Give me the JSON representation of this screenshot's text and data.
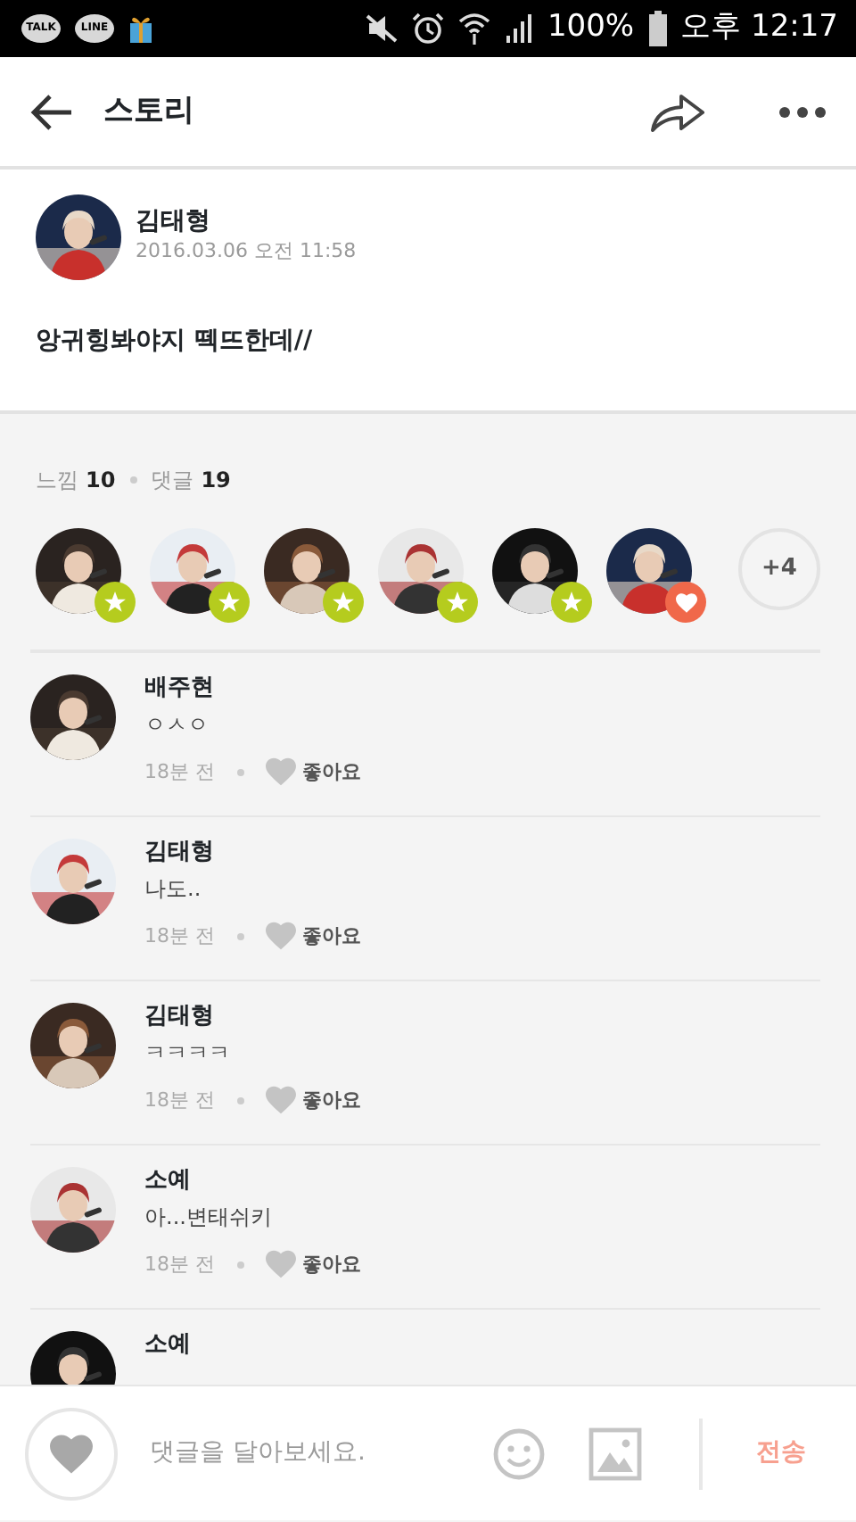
{
  "status_bar": {
    "notifications": [
      "TALK",
      "LINE"
    ],
    "battery_text": "100%",
    "time": "오후 12:17"
  },
  "header": {
    "title": "스토리"
  },
  "post": {
    "author": "김태형",
    "date": "2016.03.06 오전 11:58",
    "text": "앙귀힝봐야지 떽뜨한데//"
  },
  "stats": {
    "feel_label": "느낌",
    "feel_count": "10",
    "comment_label": "댓글",
    "comment_count": "19"
  },
  "reactors": [
    {
      "kind": "star"
    },
    {
      "kind": "star"
    },
    {
      "kind": "star"
    },
    {
      "kind": "star"
    },
    {
      "kind": "star"
    },
    {
      "kind": "heart"
    }
  ],
  "more_reactors": "+4",
  "comments": [
    {
      "author": "배주현",
      "text": "ㅇㅅㅇ",
      "time": "18분 전",
      "like_label": "좋아요",
      "liked": false
    },
    {
      "author": "김태형",
      "text": "나도..",
      "time": "18분 전",
      "like_label": "좋아요",
      "liked": false
    },
    {
      "author": "김태형",
      "text": "ㅋㅋㅋㅋ",
      "time": "18분 전",
      "like_label": "좋아요",
      "liked": false
    },
    {
      "author": "소예",
      "text": "아...변태쉬키",
      "time": "18분 전",
      "like_label": "좋아요",
      "liked": false
    },
    {
      "author": "소예"
    }
  ],
  "composer": {
    "liked": false,
    "placeholder": "댓글을 달아보세요.",
    "send": "전송"
  }
}
